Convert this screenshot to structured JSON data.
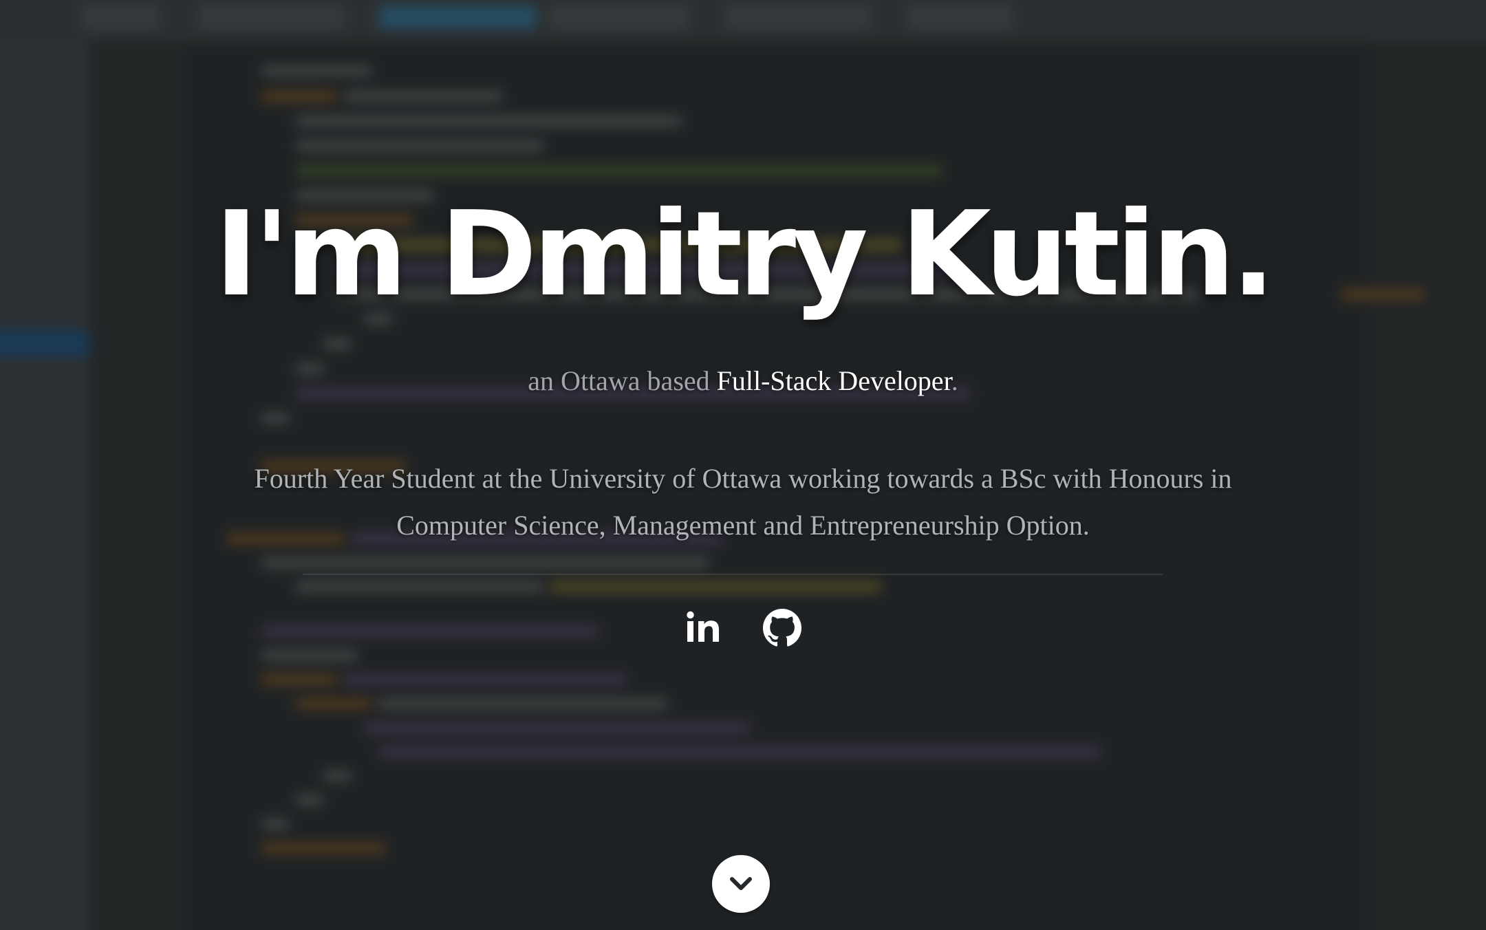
{
  "hero": {
    "headline": "I'm Dmitry Kutin.",
    "subtitle": {
      "prefix": "an Ottawa based ",
      "role": "Full-Stack Developer",
      "suffix": "."
    },
    "description": "Fourth Year Student at the University of Ottawa working towards a BSc with Honours in Computer Science, Management and Entrepreneurship Option."
  },
  "social": [
    {
      "name": "LinkedIn",
      "icon": "linkedin-icon"
    },
    {
      "name": "GitHub",
      "icon": "github-icon"
    }
  ],
  "scroll_button": {
    "icon": "chevron-down-icon"
  },
  "colors": {
    "background": "#1f2224",
    "headline": "#ffffff",
    "subtitle_muted": "#a3a6a9",
    "subtitle_accent": "#ffffff",
    "description": "#b1b4b7"
  }
}
